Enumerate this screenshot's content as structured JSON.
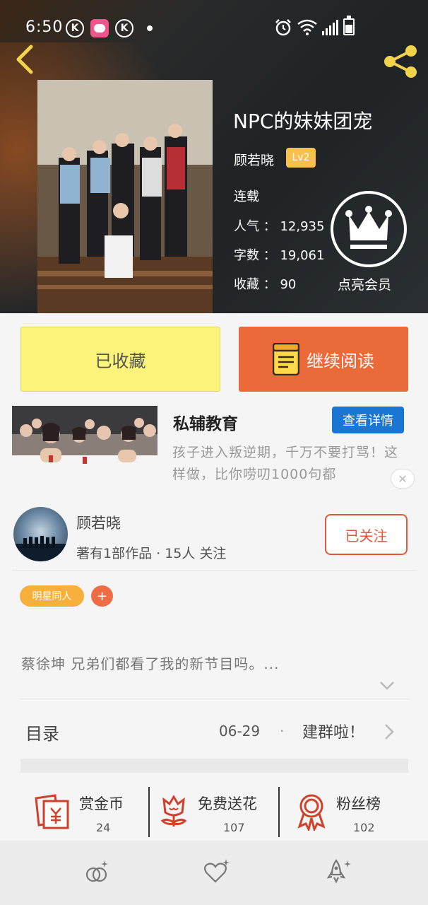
{
  "status_bar": {
    "time": "6:50",
    "k_glyph": "K",
    "icons": [
      "k-circle-icon",
      "app-notification-icon",
      "k-circle-icon",
      "dot-icon",
      "alarm-icon",
      "wifi-icon",
      "signal-icon",
      "battery-icon"
    ]
  },
  "header": {
    "title": "NPC的妹妹团宠",
    "author": "顾若晓",
    "level": "Lv2",
    "status": "连载",
    "popularity": "人气 ： 12,935",
    "words": "字数 ： 19,061",
    "favorites": "收藏 ： 90",
    "vip_label": "点亮会员"
  },
  "actions": {
    "collected_label": "已收藏",
    "read_label": "继续阅读"
  },
  "ad": {
    "title": "私辅教育",
    "button": "查看详情",
    "description": "孩子进入叛逆期，千万不要打骂！这样做，比你唠叨1000句都"
  },
  "author_card": {
    "name": "顾若晓",
    "meta": "著有1部作品 · 15人 关注",
    "follow_label": "已关注"
  },
  "tags": {
    "items": [
      "明星同人"
    ],
    "add": "+"
  },
  "summary": "蔡徐坤 兄弟们都看了我的新节目吗。...",
  "toc": {
    "label": "目录",
    "date": "06-29",
    "dot": "·",
    "latest": "建群啦！"
  },
  "rewards": [
    {
      "label": "赏金币",
      "count": "24"
    },
    {
      "label": "免费送花",
      "count": "107"
    },
    {
      "label": "粉丝榜",
      "count": "102"
    }
  ],
  "colors": {
    "accent_orange": "#eb6a3a",
    "yellow_button": "#fbf37a",
    "level_badge": "#f5c14a",
    "ad_blue": "#1976d2",
    "tag_orange": "#f7b03b",
    "reward_red": "#d0412c"
  }
}
